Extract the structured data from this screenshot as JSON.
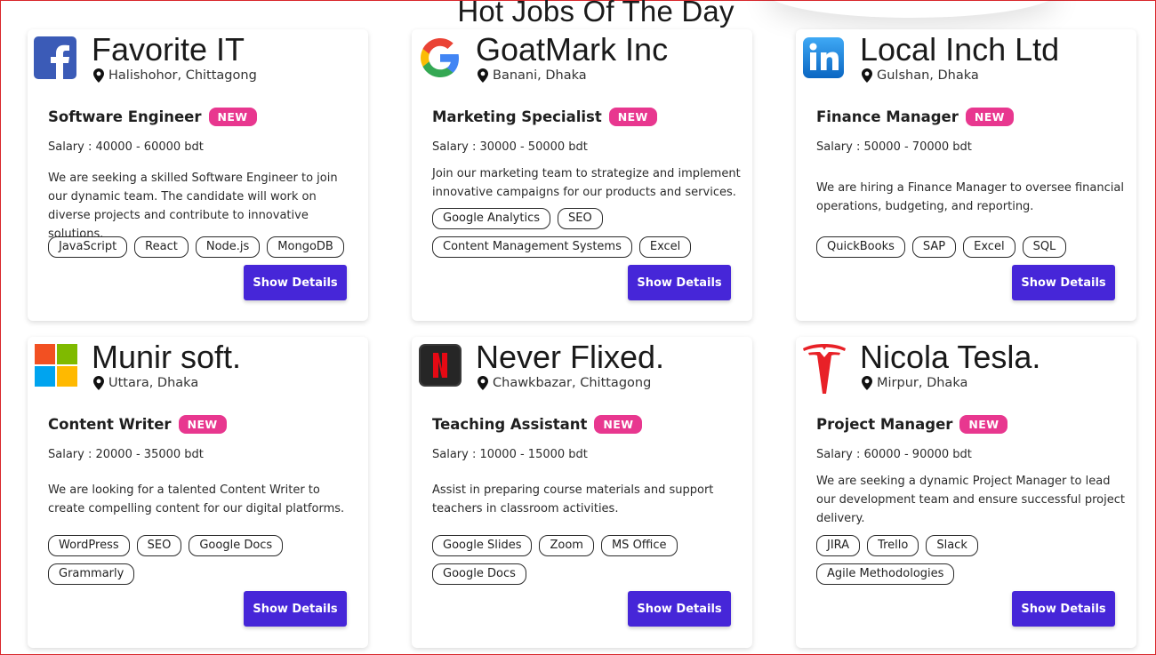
{
  "page": {
    "title": "Hot Jobs Of The Day"
  },
  "ui": {
    "badge_label": "NEW",
    "salary_prefix": "Salary : ",
    "button_label": "Show Details"
  },
  "jobs": [
    {
      "company": "Favorite IT",
      "location": "Halishohor, Chittagong",
      "logo": "facebook-logo",
      "title": "Software Engineer",
      "salary": "40000 - 60000 bdt",
      "description": "We are seeking a skilled Software Engineer to join our dynamic team. The candidate will work on diverse projects and contribute to innovative solutions.",
      "skills": [
        "JavaScript",
        "React",
        "Node.js",
        "MongoDB"
      ]
    },
    {
      "company": "GoatMark Inc",
      "location": "Banani, Dhaka",
      "logo": "google-logo",
      "title": "Marketing Specialist",
      "salary": "30000 - 50000 bdt",
      "description": "Join our marketing team to strategize and implement innovative campaigns for our products and services.",
      "skills": [
        "Google Analytics",
        "SEO",
        "Content Management Systems",
        "Excel"
      ]
    },
    {
      "company": "Local Inch Ltd",
      "location": "Gulshan, Dhaka",
      "logo": "linkedin-logo",
      "title": "Finance Manager",
      "salary": "50000 - 70000 bdt",
      "description": "We are hiring a Finance Manager to oversee financial operations, budgeting, and reporting.",
      "skills": [
        "QuickBooks",
        "SAP",
        "Excel",
        "SQL"
      ]
    },
    {
      "company": "Munir soft.",
      "location": "Uttara, Dhaka",
      "logo": "microsoft-logo",
      "title": "Content Writer",
      "salary": "20000 - 35000 bdt",
      "description": "We are looking for a talented Content Writer to create compelling content for our digital platforms.",
      "skills": [
        "WordPress",
        "SEO",
        "Google Docs",
        "Grammarly"
      ]
    },
    {
      "company": "Never Flixed.",
      "location": "Chawkbazar, Chittagong",
      "logo": "netflix-logo",
      "title": "Teaching Assistant",
      "salary": "10000 - 15000 bdt",
      "description": "Assist in preparing course materials and support teachers in classroom activities.",
      "skills": [
        "Google Slides",
        "Zoom",
        "MS Office",
        "Google Docs"
      ]
    },
    {
      "company": "Nicola Tesla.",
      "location": "Mirpur, Dhaka",
      "logo": "tesla-logo",
      "title": "Project Manager",
      "salary": "60000 - 90000 bdt",
      "description": "We are seeking a dynamic Project Manager to lead our development team and ensure successful project delivery.",
      "skills": [
        "JIRA",
        "Trello",
        "Slack",
        "Agile Methodologies"
      ]
    }
  ],
  "colors": {
    "accent": "#4626d8",
    "badge": "#e8378f",
    "frame": "#d9262b"
  }
}
